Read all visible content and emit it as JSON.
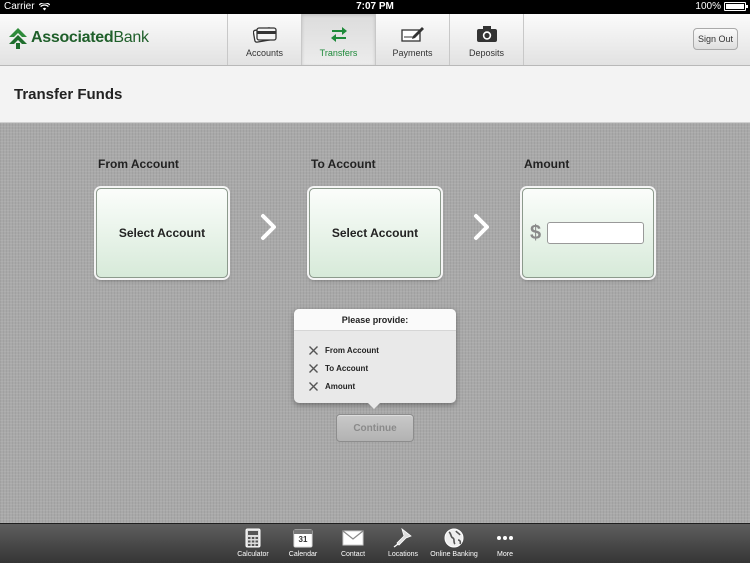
{
  "status_bar": {
    "carrier": "Carrier",
    "time": "7:07 PM",
    "battery": "100%"
  },
  "brand": {
    "name_part1": "Associated",
    "name_part2": "Bank",
    "color": "#1f5f2a"
  },
  "nav": {
    "tabs": [
      {
        "label": "Accounts",
        "icon": "card-icon",
        "active": false
      },
      {
        "label": "Transfers",
        "icon": "transfer-arrows-icon",
        "active": true
      },
      {
        "label": "Payments",
        "icon": "check-pen-icon",
        "active": false
      },
      {
        "label": "Deposits",
        "icon": "camera-icon",
        "active": false
      }
    ],
    "sign_out": "Sign Out",
    "active_color": "#1e8a3a"
  },
  "page": {
    "title": "Transfer Funds"
  },
  "transfer": {
    "from": {
      "label": "From Account",
      "button": "Select Account"
    },
    "to": {
      "label": "To Account",
      "button": "Select Account"
    },
    "amount": {
      "label": "Amount",
      "currency": "$",
      "value": ""
    }
  },
  "validation": {
    "heading": "Please provide:",
    "items": [
      "From Account",
      "To Account",
      "Amount"
    ]
  },
  "continue_label": "Continue",
  "toolbar": {
    "items": [
      {
        "label": "Calculator",
        "icon": "calculator-icon"
      },
      {
        "label": "Calendar",
        "icon": "calendar-icon",
        "badge": "31"
      },
      {
        "label": "Contact",
        "icon": "envelope-icon"
      },
      {
        "label": "Locations",
        "icon": "map-pin-icon"
      },
      {
        "label": "Online Banking",
        "icon": "globe-icon"
      },
      {
        "label": "More",
        "icon": "more-dots-icon"
      }
    ]
  }
}
